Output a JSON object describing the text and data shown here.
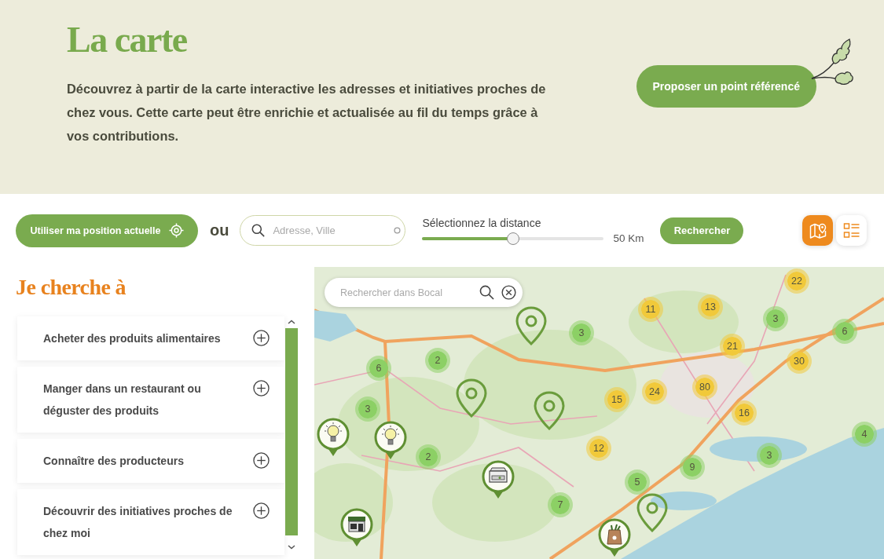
{
  "header": {
    "title": "La carte",
    "description": "Découvrez à partir de la carte interactive les adresses et initiatives proches de chez vous. Cette carte peut être enrichie et actualisée au fil du temps grâce à vos contributions.",
    "button": "Proposer un point référencé"
  },
  "search_bar": {
    "locate_button": "Utiliser ma position actuelle",
    "separator": "ou",
    "address_field": {
      "placeholder": "Adresse, Ville"
    },
    "distance": {
      "label": "Sélectionnez la distance",
      "level": 0.5,
      "reading": "50 Km"
    },
    "search_button": "Rechercher",
    "view_tabs": [
      {
        "kind": "map",
        "selected": true
      },
      {
        "kind": "list",
        "selected": false
      }
    ]
  },
  "sidebar": {
    "title": "Je cherche à",
    "items": [
      {
        "label": "Acheter des produits alimentaires",
        "expanded": false
      },
      {
        "label": "Manger dans un restaurant ou déguster des produits",
        "expanded": false
      },
      {
        "label": "Connaître des producteurs",
        "expanded": false
      },
      {
        "label": "Découvrir des initiatives proches de chez moi",
        "expanded": false
      }
    ]
  },
  "map": {
    "search_field": {
      "placeholder": "Rechercher dans Bocal"
    },
    "clusters": [
      {
        "count": "22",
        "color": "#f1c93a"
      },
      {
        "count": "11",
        "color": "#f1c93a"
      },
      {
        "count": "13",
        "color": "#f1c93a"
      },
      {
        "count": "3",
        "color": "#8cd065"
      },
      {
        "count": "6",
        "color": "#8cd065"
      },
      {
        "count": "3",
        "color": "#8cd065"
      },
      {
        "count": "21",
        "color": "#f1c93a"
      },
      {
        "count": "2",
        "color": "#8cd065"
      },
      {
        "count": "30",
        "color": "#f1c93a"
      },
      {
        "count": "6",
        "color": "#8cd065"
      },
      {
        "count": "80",
        "color": "#f1c93a"
      },
      {
        "count": "24",
        "color": "#f1c93a"
      },
      {
        "count": "15",
        "color": "#f1c93a"
      },
      {
        "count": "3",
        "color": "#8cd065"
      },
      {
        "count": "16",
        "color": "#f1c93a"
      },
      {
        "count": "4",
        "color": "#8cd065"
      },
      {
        "count": "12",
        "color": "#f1c93a"
      },
      {
        "count": "3",
        "color": "#8cd065"
      },
      {
        "count": "2",
        "color": "#8cd065"
      },
      {
        "count": "9",
        "color": "#8cd065"
      },
      {
        "count": "5",
        "color": "#8cd065"
      },
      {
        "count": "7",
        "color": "#8cd065"
      }
    ]
  }
}
